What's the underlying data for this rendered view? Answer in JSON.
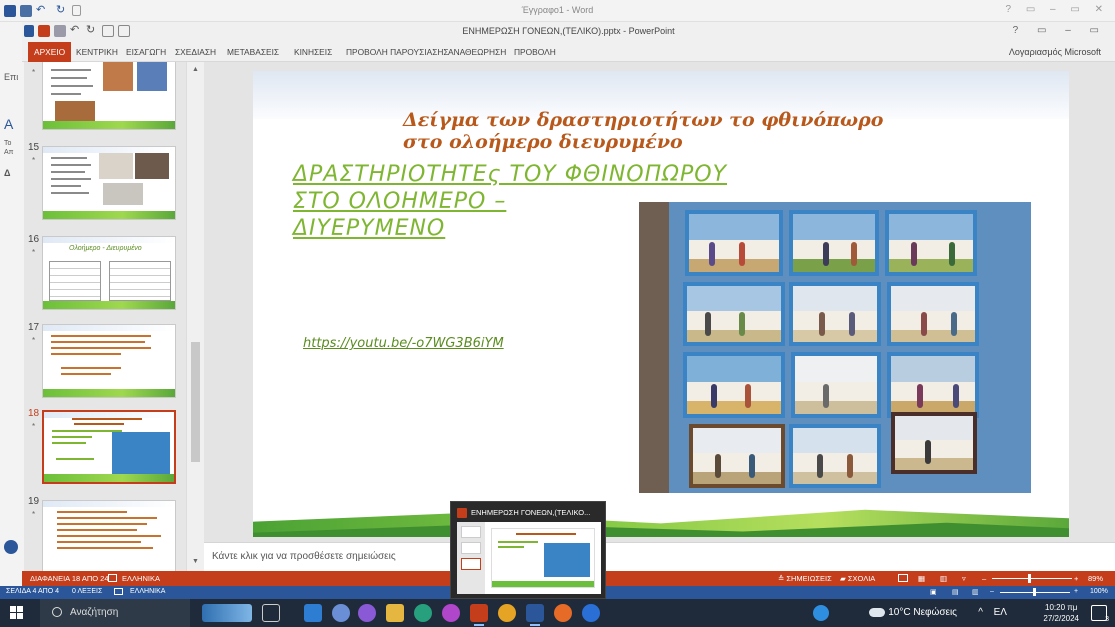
{
  "word": {
    "title": "Έγγραφο1 - Word",
    "side_labels": [
      "Επι",
      "A",
      "Το",
      "Απ",
      "Δ"
    ],
    "status": {
      "page": "ΣΕΛΙΔΑ 4 ΑΠΟ 4",
      "words": "0 ΛΕΞΕΙΣ",
      "language": "ΕΛΛΗΝΙΚΑ",
      "zoom": "100%"
    },
    "window_controls": "? ▭ – ▭ ✕"
  },
  "powerpoint": {
    "title": "ΕΝΗΜΕΡΩΣΗ ΓΟΝΕΩΝ,(ΤΕΛΙΚΟ).pptx - PowerPoint",
    "window_controls": "? ▭ – ▭",
    "account": "Λογαριασμός Microsoft",
    "tabs": [
      "ΑΡΧΕΙΟ",
      "ΚΕΝΤΡΙΚΗ",
      "ΕΙΣΑΓΩΓΗ",
      "ΣΧΕΔΙΑΣΗ",
      "ΜΕΤΑΒΑΣΕΙΣ",
      "ΚΙΝΗΣΕΙΣ",
      "ΠΡΟΒΟΛΗ ΠΑΡΟΥΣΙΑΣΗΣ",
      "ΑΝΑΘΕΩΡΗΣΗ",
      "ΠΡΟΒΟΛΗ"
    ],
    "active_tab": "ΑΡΧΕΙΟ",
    "thumbnails": [
      {
        "num": "",
        "star": "*"
      },
      {
        "num": "15",
        "star": "*"
      },
      {
        "num": "16",
        "star": "*",
        "title": "Ολοήμερο - Διευρυμένο"
      },
      {
        "num": "17",
        "star": "*"
      },
      {
        "num": "18",
        "star": "*",
        "selected": true
      },
      {
        "num": "19",
        "star": "*"
      }
    ],
    "slide": {
      "title_line1": "Δείγμα των δραστηριοτήτων το φθινόπωρο",
      "title_line2": "στο ολοήμερο διευρυμένο",
      "heading_line1": "ΔΡΑΣΤΗΡΙΟΤΗΤΕς ΤΟΥ ΦΘΙΝΟΠΩΡΟΥ",
      "heading_line2": "ΣΤΟ ΟΛΟΗΜΕΡΟ –",
      "heading_line3": "ΔΙΥΕΡΥΜΕΝΟ",
      "link": "https://youtu.be/-o7WG3B6iYM"
    },
    "notes_placeholder": "Κάντε κλικ για να προσθέσετε σημειώσεις",
    "status": {
      "slide": "ΔΙΑΦΑΝΕΙΑ 18 ΑΠΟ 24",
      "language": "ΕΛΛΗΝΙΚΑ",
      "notes": "ΣΗΜΕΙΩΣΕΙΣ",
      "comments": "ΣΧΟΛΙΑ",
      "zoom": "89%"
    },
    "accent": "#c43e1c"
  },
  "preview": {
    "title": "ΕΝΗΜΕΡΩΣΗ ΓΟΝΕΩΝ,(ΤΕΛΙΚΟ..."
  },
  "taskbar": {
    "search_placeholder": "Αναζήτηση",
    "weather": "10°C Νεφώσεις",
    "language": "ΕΛ",
    "time": "10:20 πμ",
    "date": "27/2/2024",
    "notification_count": "3"
  }
}
